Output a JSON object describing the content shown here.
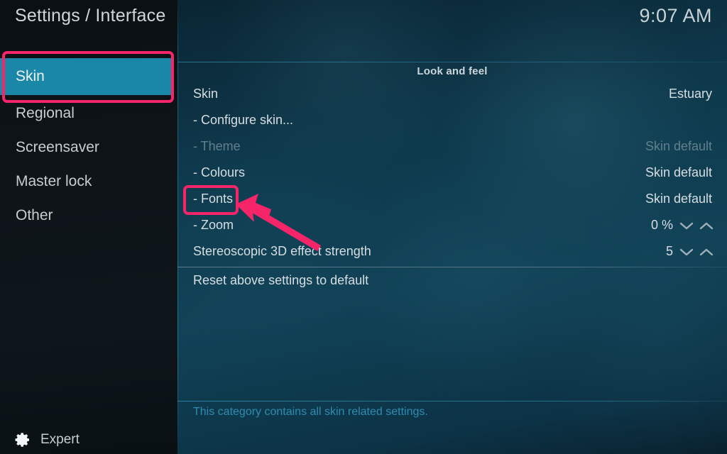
{
  "header": {
    "title": "Settings / Interface",
    "clock": "9:07 AM"
  },
  "sidebar": {
    "items": [
      {
        "label": "Skin",
        "selected": true
      },
      {
        "label": "Regional",
        "selected": false
      },
      {
        "label": "Screensaver",
        "selected": false
      },
      {
        "label": "Master lock",
        "selected": false
      },
      {
        "label": "Other",
        "selected": false
      }
    ],
    "footer": {
      "icon": "gear-icon",
      "label": "Expert"
    }
  },
  "main": {
    "group_title": "Look and feel",
    "rows": [
      {
        "label": "Skin",
        "value": "Estuary",
        "disabled": false,
        "spinner": false
      },
      {
        "label": "- Configure skin...",
        "value": "",
        "disabled": false,
        "spinner": false
      },
      {
        "label": "- Theme",
        "value": "Skin default",
        "disabled": true,
        "spinner": false
      },
      {
        "label": "- Colours",
        "value": "Skin default",
        "disabled": false,
        "spinner": false
      },
      {
        "label": "- Fonts",
        "value": "Skin default",
        "disabled": false,
        "spinner": false
      },
      {
        "label": "- Zoom",
        "value": "0 %",
        "disabled": false,
        "spinner": true
      },
      {
        "label": "Stereoscopic 3D effect strength",
        "value": "5",
        "disabled": false,
        "spinner": true
      }
    ],
    "reset_row": {
      "label": "Reset above settings to default"
    },
    "help_text": "This category contains all skin related settings."
  },
  "annotations": {
    "color": "#f6256a",
    "boxes": [
      {
        "name": "skin-sidebar-highlight"
      },
      {
        "name": "fonts-row-highlight"
      }
    ],
    "arrow": {
      "name": "pointer-arrow",
      "points_to": "- Fonts"
    }
  },
  "colors": {
    "selection_teal": "#1b87a8",
    "panel_bg": "#103d52",
    "sidebar_bg": "#0e1418",
    "help_teal": "#2e8cb0",
    "annotation_pink": "#f6256a"
  }
}
